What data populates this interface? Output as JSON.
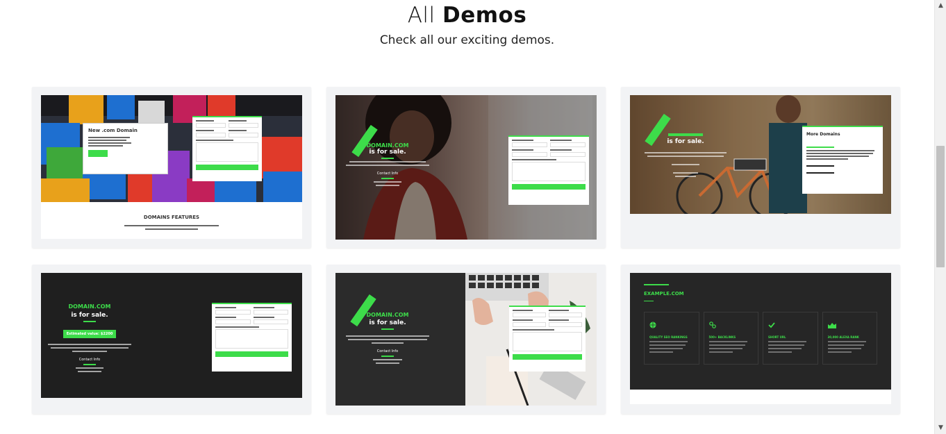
{
  "heading": {
    "title_light": "All",
    "title_bold": "Demos",
    "subtitle": "Check all our exciting demos."
  },
  "demos": [
    {
      "feature_title": "DOMAINS FEATURES",
      "box_title": "New .com Domain"
    },
    {
      "domain": "DOMAIN.COM",
      "sale": "is for sale.",
      "contact": "Contact Info"
    },
    {
      "box_title": "More Domains",
      "sale": "is for sale."
    },
    {
      "domain": "DOMAIN.COM",
      "sale": "is for sale.",
      "value": "Estimated value: $2200",
      "contact": "Contact Info"
    },
    {
      "domain": "DOMAIN.COM",
      "sale": "is for sale.",
      "contact": "Contact Info"
    },
    {
      "domain": "EXAMPLE.COM",
      "features": [
        "QUALITY SEO RANKINGS",
        "500+ BACKLINKS",
        "SHORT URL",
        "30,000 ALEXA RANK"
      ]
    }
  ],
  "colors": {
    "accent": "#3ddc4a",
    "card_bg": "#f2f3f5"
  }
}
